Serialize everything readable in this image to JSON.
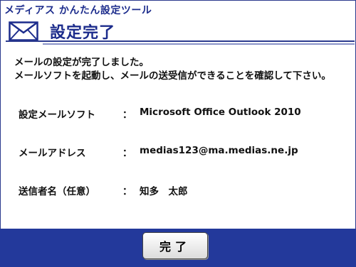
{
  "app_title": "メディアス かんたん設定ツール",
  "header": {
    "title": "設定完了",
    "icon": "mail-envelope-icon"
  },
  "message": {
    "line1": "メールの設定が完了しました。",
    "line2": "メールソフトを起動し、メールの送受信ができることを確認して下さい。"
  },
  "settings": [
    {
      "label": "設定メールソフト",
      "separator": "：",
      "value": "Microsoft Office Outlook 2010"
    },
    {
      "label": "メールアドレス",
      "separator": "：",
      "value": "medias123@ma.medias.ne.jp"
    },
    {
      "label": "送信者名（任意）",
      "separator": "：",
      "value": "知多　太郎"
    }
  ],
  "footer": {
    "done_label": "完了"
  },
  "colors": {
    "accent": "#1c2c8c",
    "footer": "#23399b"
  }
}
